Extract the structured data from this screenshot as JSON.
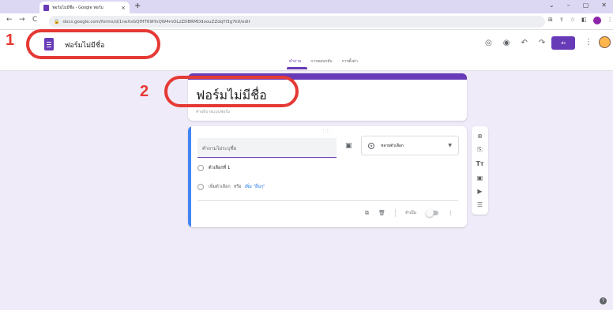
{
  "browser": {
    "tab_title": "ฟอร์มไม่มีชื่อ - Google ฟอร์ม",
    "tab_close": "×",
    "new_tab": "+",
    "window_controls": [
      "⌄",
      "–",
      "▢",
      "✕"
    ],
    "url": "docs.google.com/forms/d/1neXsGQfHT69HnQW4mOLzZDBRMDdoouZZdqYl3g7k0/edit",
    "nav_icons": [
      "←",
      "→",
      "C"
    ]
  },
  "header": {
    "form_name": "ฟอร์มไม่มีชื่อ",
    "send_label": "ส่ง",
    "tabs": [
      "คำถาม",
      "การตอบกลับ",
      "การตั้งค่า"
    ]
  },
  "form": {
    "title": "ฟอร์มไม่มีชื่อ",
    "description_placeholder": "คำอธิบายแบบฟอร์ม"
  },
  "question": {
    "placeholder": "คำถามไม่ระบุชื่อ",
    "type": "หลายตัวเลือก",
    "option1": "ตัวเลือกที่ 1",
    "add_option": "เพิ่มตัวเลือก",
    "or": "หรือ",
    "add_other": "เพิ่ม \"อื่นๆ\"",
    "required_label": "จำเป็น",
    "required": false
  },
  "annotations": {
    "label1": "1",
    "label2": "2"
  },
  "colors": {
    "accent": "#673ab7",
    "canvas": "#f0ebf8",
    "annotation": "#e53935",
    "active_question_bar": "#4285f4"
  }
}
